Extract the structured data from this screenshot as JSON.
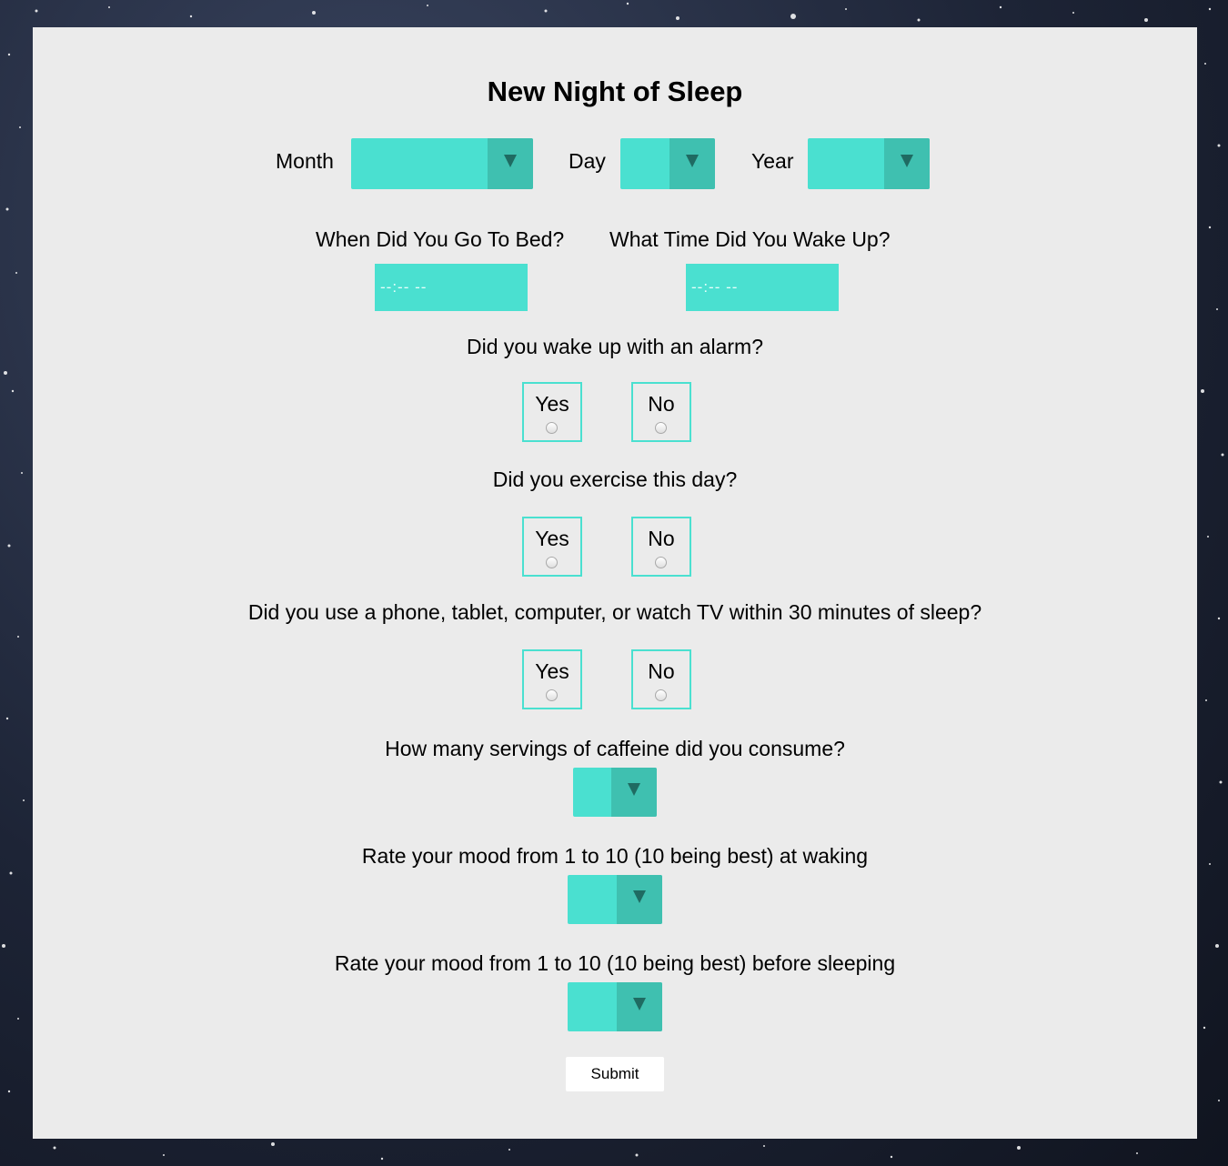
{
  "form": {
    "title": "New Night of Sleep",
    "date": {
      "month_label": "Month",
      "day_label": "Day",
      "year_label": "Year",
      "month_value": "",
      "day_value": "",
      "year_value": ""
    },
    "bed_time": {
      "label": "When Did You Go To Bed?",
      "placeholder": "--:-- --"
    },
    "wake_time": {
      "label": "What Time Did You Wake Up?",
      "placeholder": "--:-- --"
    },
    "alarm": {
      "question": "Did you wake up with an alarm?",
      "yes": "Yes",
      "no": "No"
    },
    "exercise": {
      "question": "Did you exercise this day?",
      "yes": "Yes",
      "no": "No"
    },
    "screens": {
      "question": "Did you use a phone, tablet, computer, or watch TV within 30 minutes of sleep?",
      "yes": "Yes",
      "no": "No"
    },
    "caffeine": {
      "question": "How many servings of caffeine did you consume?",
      "value": ""
    },
    "mood_waking": {
      "question": "Rate your mood from 1 to 10 (10 being best) at waking",
      "value": ""
    },
    "mood_sleeping": {
      "question": "Rate your mood from 1 to 10 (10 being best) before sleeping",
      "value": ""
    },
    "submit_label": "Submit"
  },
  "colors": {
    "panel_bg": "#ebebeb",
    "accent": "#4ae0d0",
    "accent_dark": "#3fc0b0",
    "arrow": "#1f6b62"
  },
  "icons": {
    "dropdown": "chevron-down-icon",
    "radio": "radio-icon"
  }
}
